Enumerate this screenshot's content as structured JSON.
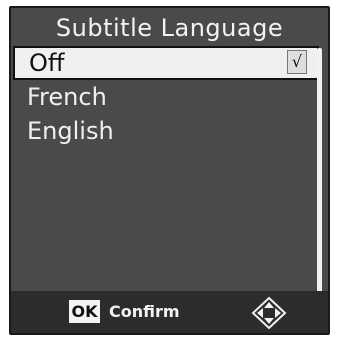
{
  "title": "Subtitle Language",
  "items": [
    {
      "label": "Off",
      "selected": true,
      "checked": true,
      "check_glyph": "√"
    },
    {
      "label": "French",
      "selected": false
    },
    {
      "label": "English",
      "selected": false
    }
  ],
  "footer": {
    "ok_label": "OK",
    "confirm_label": "Confirm",
    "nav_icon": "dpad-icon"
  }
}
